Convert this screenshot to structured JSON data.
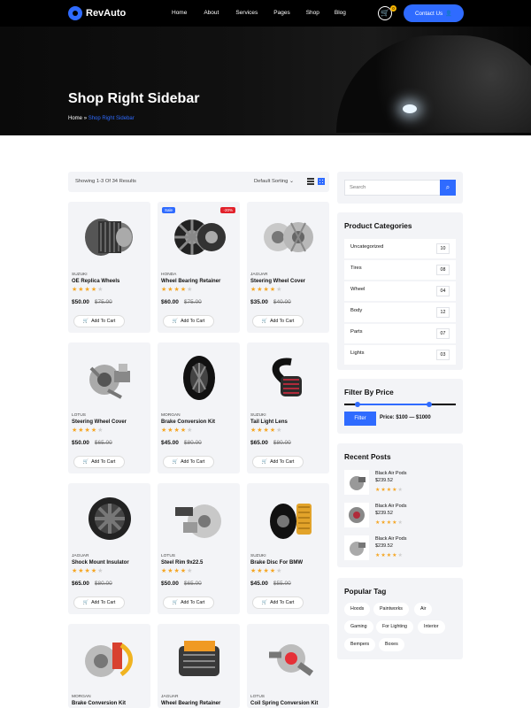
{
  "brand": {
    "name": "RevAuto"
  },
  "nav": [
    "Home",
    "About",
    "Services",
    "Pages",
    "Shop",
    "Blog"
  ],
  "cart": {
    "count": "0"
  },
  "contact": {
    "label": "Contact Us"
  },
  "hero": {
    "title": "Shop Right Sidebar"
  },
  "breadcrumb": {
    "home": "Home",
    "current": "Shop Right Sidebar"
  },
  "shop": {
    "results": "Showing 1-3 Of 34 Results",
    "sort": "Default Sorting"
  },
  "products": [
    {
      "brand": "SUZUKI",
      "name": "OE Replica Wheels",
      "price": "$50.00",
      "old": "$75.00",
      "cart": "Add To Cart",
      "rating": 4
    },
    {
      "brand": "HONDA",
      "name": "Wheel Bearing Retainer",
      "price": "$60.00",
      "old": "$75.00",
      "cart": "Add To Cart",
      "rating": 4,
      "sale": "Sale",
      "off": "-20%"
    },
    {
      "brand": "JAGUAR",
      "name": "Steering Wheel Cover",
      "price": "$35.00",
      "old": "$40.00",
      "cart": "Add To Cart",
      "rating": 4
    },
    {
      "brand": "LOTUS",
      "name": "Steering Wheel Cover",
      "price": "$50.00",
      "old": "$65.00",
      "cart": "Add To Cart",
      "rating": 4
    },
    {
      "brand": "MORGAN",
      "name": "Brake Conversion Kit",
      "price": "$45.00",
      "old": "$80.00",
      "cart": "Add To Cart",
      "rating": 4
    },
    {
      "brand": "SUZUKI",
      "name": "Tail Light Lens",
      "price": "$65.00",
      "old": "$80.00",
      "cart": "Add To Cart",
      "rating": 4
    },
    {
      "brand": "JAGUAR",
      "name": "Shock Mount Insulator",
      "price": "$65.00",
      "old": "$80.00",
      "cart": "Add To Cart",
      "rating": 4
    },
    {
      "brand": "LOTUS",
      "name": "Steel Rim 9x22.5",
      "price": "$50.00",
      "old": "$65.00",
      "cart": "Add To Cart",
      "rating": 4
    },
    {
      "brand": "SUZUKI",
      "name": "Brake Disc For BMW",
      "price": "$45.00",
      "old": "$55.00",
      "cart": "Add To Cart",
      "rating": 4
    },
    {
      "brand": "MORGAN",
      "name": "Brake Conversion Kit",
      "price": "",
      "old": "",
      "cart": "",
      "rating": 0
    },
    {
      "brand": "JAGUAR",
      "name": "Wheel Bearing Retainer",
      "price": "",
      "old": "",
      "cart": "",
      "rating": 0
    },
    {
      "brand": "LOTUS",
      "name": "Coil Spring Conversion Kit",
      "price": "",
      "old": "",
      "cart": "",
      "rating": 0
    }
  ],
  "search": {
    "placeholder": "Search"
  },
  "categories": {
    "title": "Product Categories",
    "items": [
      {
        "label": "Uncategorized",
        "count": "10"
      },
      {
        "label": "Tires",
        "count": "08"
      },
      {
        "label": "Wheel",
        "count": "04"
      },
      {
        "label": "Body",
        "count": "12"
      },
      {
        "label": "Parts",
        "count": "07"
      },
      {
        "label": "Lights",
        "count": "03"
      }
    ]
  },
  "price_filter": {
    "title": "Filter By Price",
    "button": "Filter",
    "range": "Price:  $100  —  $1000"
  },
  "recent_posts": {
    "title": "Recent Posts",
    "items": [
      {
        "title": "Black Air Pods",
        "price": "$239.52",
        "rating": 4
      },
      {
        "title": "Black Air Pods",
        "price": "$239.52",
        "rating": 4
      },
      {
        "title": "Black Air Pods",
        "price": "$239.52",
        "rating": 4
      }
    ]
  },
  "tags": {
    "title": "Popular Tag",
    "items": [
      "Hoods",
      "Paintworks",
      "Air",
      "Gaming",
      "For Lighting",
      "Interior",
      "Bempers",
      "Boxes"
    ]
  },
  "colors": {
    "accent": "#2f6bff",
    "star": "#f5a623",
    "sale": "#2f6bff",
    "discount": "#e2212b"
  }
}
